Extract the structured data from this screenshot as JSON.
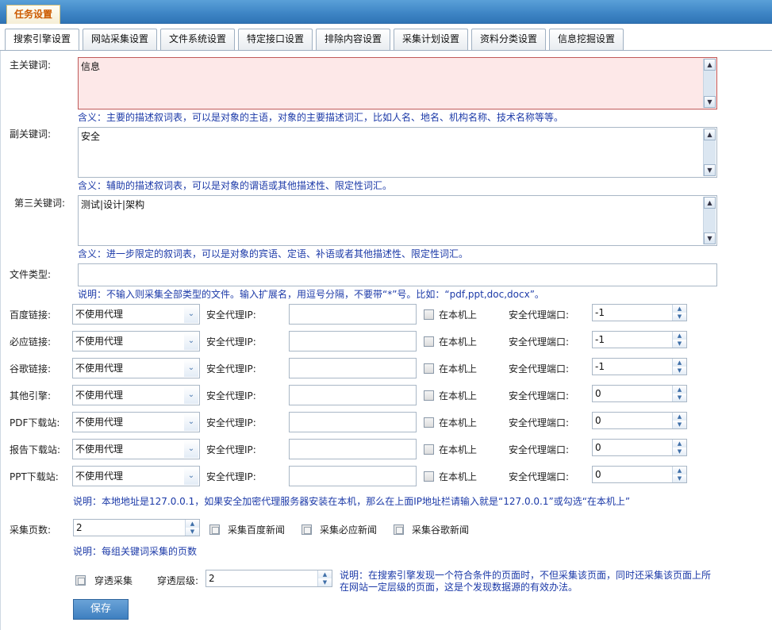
{
  "header": {
    "title": "任务设置"
  },
  "tabs": [
    {
      "label": "搜索引擎设置",
      "active": true
    },
    {
      "label": "网站采集设置"
    },
    {
      "label": "文件系统设置"
    },
    {
      "label": "特定接口设置"
    },
    {
      "label": "排除内容设置"
    },
    {
      "label": "采集计划设置"
    },
    {
      "label": "资料分类设置"
    },
    {
      "label": "信息挖掘设置"
    }
  ],
  "keywords": {
    "main": {
      "label": "主关键词:",
      "value": "信息",
      "note": "含义：主要的描述叙词表，可以是对象的主语，对象的主要描述词汇，比如人名、地名、机构名称、技术名称等等。"
    },
    "secondary": {
      "label": "副关键词:",
      "value": "安全",
      "note": "含义：辅助的描述叙词表，可以是对象的谓语或其他描述性、限定性词汇。"
    },
    "third": {
      "label": "第三关键词:",
      "value": "测试|设计|架构",
      "note": "含义：进一步限定的叙词表，可以是对象的宾语、定语、补语或者其他描述性、限定性词汇。"
    }
  },
  "filetype": {
    "label": "文件类型:",
    "value": "",
    "note": "说明：不输入则采集全部类型的文件。输入扩展名，用逗号分隔，不要带“*”号。比如：“pdf,ppt,doc,docx”。"
  },
  "engine_rows": [
    {
      "label": "百度链接:",
      "proxy": "不使用代理",
      "port": "-1"
    },
    {
      "label": "必应链接:",
      "proxy": "不使用代理",
      "port": "-1"
    },
    {
      "label": "谷歌链接:",
      "proxy": "不使用代理",
      "port": "-1"
    },
    {
      "label": "其他引擎:",
      "proxy": "不使用代理",
      "port": "0"
    },
    {
      "label": "PDF下载站:",
      "proxy": "不使用代理",
      "port": "0"
    },
    {
      "label": "报告下载站:",
      "proxy": "不使用代理",
      "port": "0"
    },
    {
      "label": "PPT下载站:",
      "proxy": "不使用代理",
      "port": "0"
    }
  ],
  "engine_common": {
    "ip_label": "安全代理IP:",
    "local_label": "在本机上",
    "port_label": "安全代理端口:"
  },
  "local_note": "说明：本地地址是127.0.0.1，如果安全加密代理服务器安装在本机，那么在上面IP地址栏请输入就是“127.0.0.1”或勾选“在本机上”",
  "pages": {
    "label": "采集页数:",
    "value": "2",
    "note": "说明：每组关键词采集的页数",
    "opt_baidu": "采集百度新闻",
    "opt_bing": "采集必应新闻",
    "opt_google": "采集谷歌新闻"
  },
  "penetrate": {
    "label": "穿透采集",
    "level_label": "穿透层级:",
    "level_value": "2",
    "note_line1": "说明：在搜索引擎发现一个符合条件的页面时，不但采集该页面，同时还采集该页面上所",
    "note_line2": "在网站一定层级的页面，这是个发现数据源的有效办法。"
  },
  "save_label": "保存"
}
